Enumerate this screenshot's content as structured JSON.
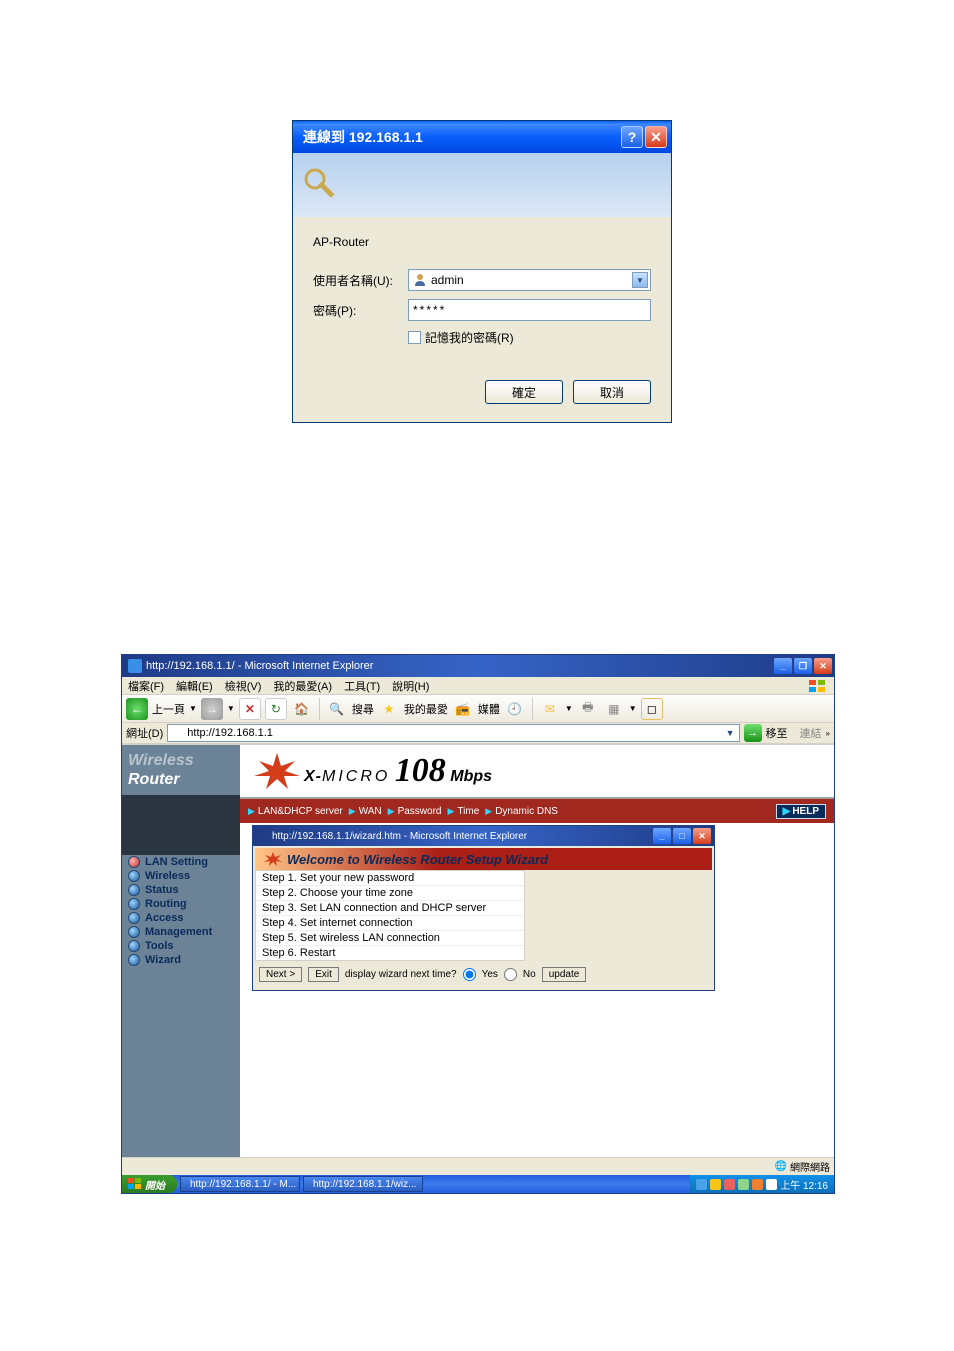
{
  "auth": {
    "title": "連線到 192.168.1.1",
    "server_label": "AP-Router",
    "username_label": "使用者名稱(U):",
    "password_label": "密碼(P):",
    "username_value": "admin",
    "password_value": "*****",
    "remember_label": "記憶我的密碼(R)",
    "ok_label": "確定",
    "cancel_label": "取消"
  },
  "browser": {
    "title": "http://192.168.1.1/ - Microsoft Internet Explorer",
    "menu": {
      "file": "檔案(F)",
      "edit": "編輯(E)",
      "view": "檢視(V)",
      "favorites": "我的最愛(A)",
      "tools": "工具(T)",
      "help": "說明(H)"
    },
    "toolbar": {
      "back": "上一頁",
      "search": "搜尋",
      "favorites": "我的最愛",
      "media": "媒體"
    },
    "address_label": "網址(D)",
    "address_value": "http://192.168.1.1",
    "go_label": "移至",
    "links_label": "連結"
  },
  "sidebar": {
    "logo_line1": "Wireless",
    "logo_line2": "Router",
    "items": [
      "LAN Setting",
      "Wireless",
      "Status",
      "Routing",
      "Access",
      "Management",
      "Tools",
      "Wizard"
    ]
  },
  "banner": {
    "brand_prefix": "X-",
    "brand_word": "MICRO",
    "speed": "108",
    "unit": "Mbps"
  },
  "tabs": {
    "items": [
      "LAN&DHCP server",
      "WAN",
      "Password",
      "Time",
      "Dynamic DNS"
    ],
    "help": "HELP"
  },
  "wizard": {
    "win_title": "http://192.168.1.1/wizard.htm - Microsoft Internet Explorer",
    "header": "Welcome to Wireless Router Setup Wizard",
    "steps": [
      "Step 1. Set your new password",
      "Step 2. Choose your time zone",
      "Step 3. Set LAN connection and DHCP server",
      "Step 4. Set internet connection",
      "Step 5. Set wireless LAN connection",
      "Step 6. Restart"
    ],
    "next_label": "Next >",
    "exit_label": "Exit",
    "display_label": "display wizard next time?",
    "yes_label": "Yes",
    "no_label": "No",
    "update_label": "update"
  },
  "statusbar": {
    "zone": "網際網路"
  },
  "taskbar": {
    "start": "開始",
    "items": [
      "http://192.168.1.1/ - M...",
      "http://192.168.1.1/wiz..."
    ],
    "clock": "上午 12:16"
  }
}
